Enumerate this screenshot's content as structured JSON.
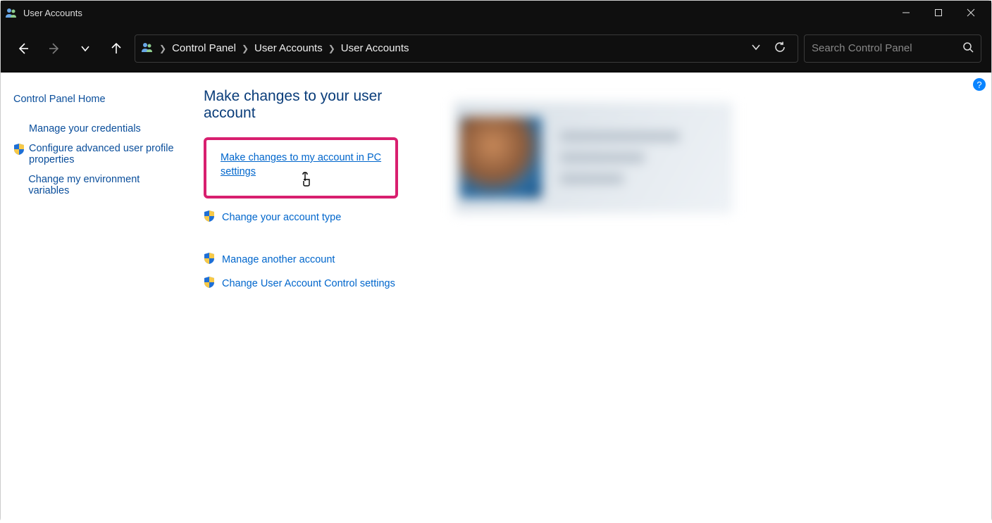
{
  "window": {
    "title": "User Accounts"
  },
  "breadcrumbs": [
    "Control Panel",
    "User Accounts",
    "User Accounts"
  ],
  "search": {
    "placeholder": "Search Control Panel"
  },
  "sidebar": {
    "home": "Control Panel Home",
    "items": [
      {
        "label": "Manage your credentials",
        "shield": false
      },
      {
        "label": "Configure advanced user profile properties",
        "shield": true
      },
      {
        "label": "Change my environment variables",
        "shield": false
      }
    ]
  },
  "main": {
    "heading": "Make changes to your user account",
    "highlighted_link": "Make changes to my account in PC settings",
    "actions": [
      {
        "label": "Change your account type",
        "shield": true
      }
    ],
    "actions2": [
      {
        "label": "Manage another account",
        "shield": true
      },
      {
        "label": "Change User Account Control settings",
        "shield": true
      }
    ]
  }
}
